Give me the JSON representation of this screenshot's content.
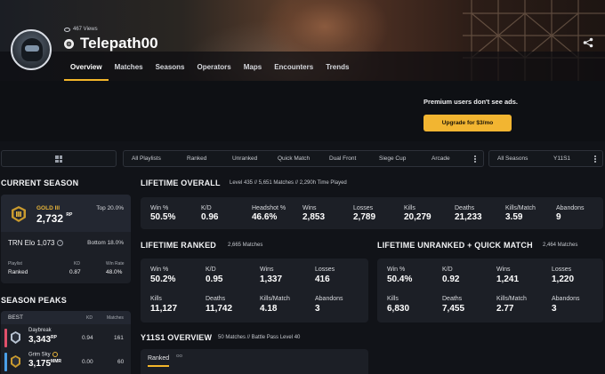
{
  "profile": {
    "views": "467 Views",
    "username": "Telepath00",
    "platform_glyph": "⊚"
  },
  "nav": {
    "tabs": [
      "Overview",
      "Matches",
      "Seasons",
      "Operators",
      "Maps",
      "Encounters",
      "Trends"
    ],
    "active": "Overview"
  },
  "ad": {
    "message": "Premium users don't see ads.",
    "upgrade_label": "Upgrade for $3/mo"
  },
  "filters": {
    "platform_icon": "windows-icon",
    "playlists": [
      "All Playlists",
      "Ranked",
      "Unranked",
      "Quick Match",
      "Dual Front",
      "Siege Cup",
      "Arcade"
    ],
    "season_label": "All Seasons",
    "season_value": "Y11S1"
  },
  "current_season": {
    "title": "CURRENT SEASON",
    "rank_name": "GOLD III",
    "rank_rp": "2,732",
    "rp_unit": "RP",
    "top_pct": "Top 20.0%",
    "elo_label": "TRN Elo 1,073",
    "bottom_pct": "Bottom 18.0%",
    "playlist_head": "Playlist",
    "kd_head": "KD",
    "winrate_head": "Win Rate",
    "playlist_value": "Ranked",
    "kd_value": "0.87",
    "winrate_value": "48.0%",
    "accent_color": "#e7b43a"
  },
  "lifetime_overall": {
    "title": "LIFETIME OVERALL",
    "meta": "Level 435 // 5,651 Matches // 2,290h Time Played",
    "stats": [
      {
        "label": "Win %",
        "value": "50.5%"
      },
      {
        "label": "K/D",
        "value": "0.96"
      },
      {
        "label": "Headshot %",
        "value": "46.6%"
      },
      {
        "label": "Wins",
        "value": "2,853"
      },
      {
        "label": "Losses",
        "value": "2,789"
      },
      {
        "label": "Kills",
        "value": "20,279"
      },
      {
        "label": "Deaths",
        "value": "21,233"
      },
      {
        "label": "Kills/Match",
        "value": "3.59"
      },
      {
        "label": "Abandons",
        "value": "9"
      }
    ]
  },
  "lifetime_ranked": {
    "title": "LIFETIME RANKED",
    "meta": "2,665 Matches",
    "stats": [
      {
        "label": "Win %",
        "value": "50.2%"
      },
      {
        "label": "K/D",
        "value": "0.95"
      },
      {
        "label": "Wins",
        "value": "1,337"
      },
      {
        "label": "Losses",
        "value": "416"
      },
      {
        "label": "Kills",
        "value": "11,127"
      },
      {
        "label": "Deaths",
        "value": "11,742"
      },
      {
        "label": "Kills/Match",
        "value": "4.18"
      },
      {
        "label": "Abandons",
        "value": "3"
      }
    ]
  },
  "lifetime_unranked": {
    "title": "LIFETIME UNRANKED + QUICK MATCH",
    "meta": "2,464 Matches",
    "stats": [
      {
        "label": "Win %",
        "value": "50.4%"
      },
      {
        "label": "K/D",
        "value": "0.92"
      },
      {
        "label": "Wins",
        "value": "1,241"
      },
      {
        "label": "Losses",
        "value": "1,220"
      },
      {
        "label": "Kills",
        "value": "6,830"
      },
      {
        "label": "Deaths",
        "value": "7,455"
      },
      {
        "label": "Kills/Match",
        "value": "2.77"
      },
      {
        "label": "Abandons",
        "value": "3"
      }
    ]
  },
  "season_peaks": {
    "title": "SEASON PEAKS",
    "best_label": "BEST",
    "kd_head": "KD",
    "matches_head": "Matches",
    "rows": [
      {
        "season": "Daybreak",
        "rp": "3,343",
        "unit": "RP",
        "kd": "0.94",
        "matches": "161",
        "color": "#e0506a"
      },
      {
        "season": "Grim Sky",
        "rp": "3,175",
        "unit": "MMR",
        "kd": "0.00",
        "matches": "60",
        "color": "#4aa0e8"
      }
    ]
  },
  "y11s1": {
    "title": "Y11S1 OVERVIEW",
    "meta": "50 Matches // Battle Pass Level 40",
    "tab_label": "Ranked",
    "tab_badge": "OO"
  }
}
